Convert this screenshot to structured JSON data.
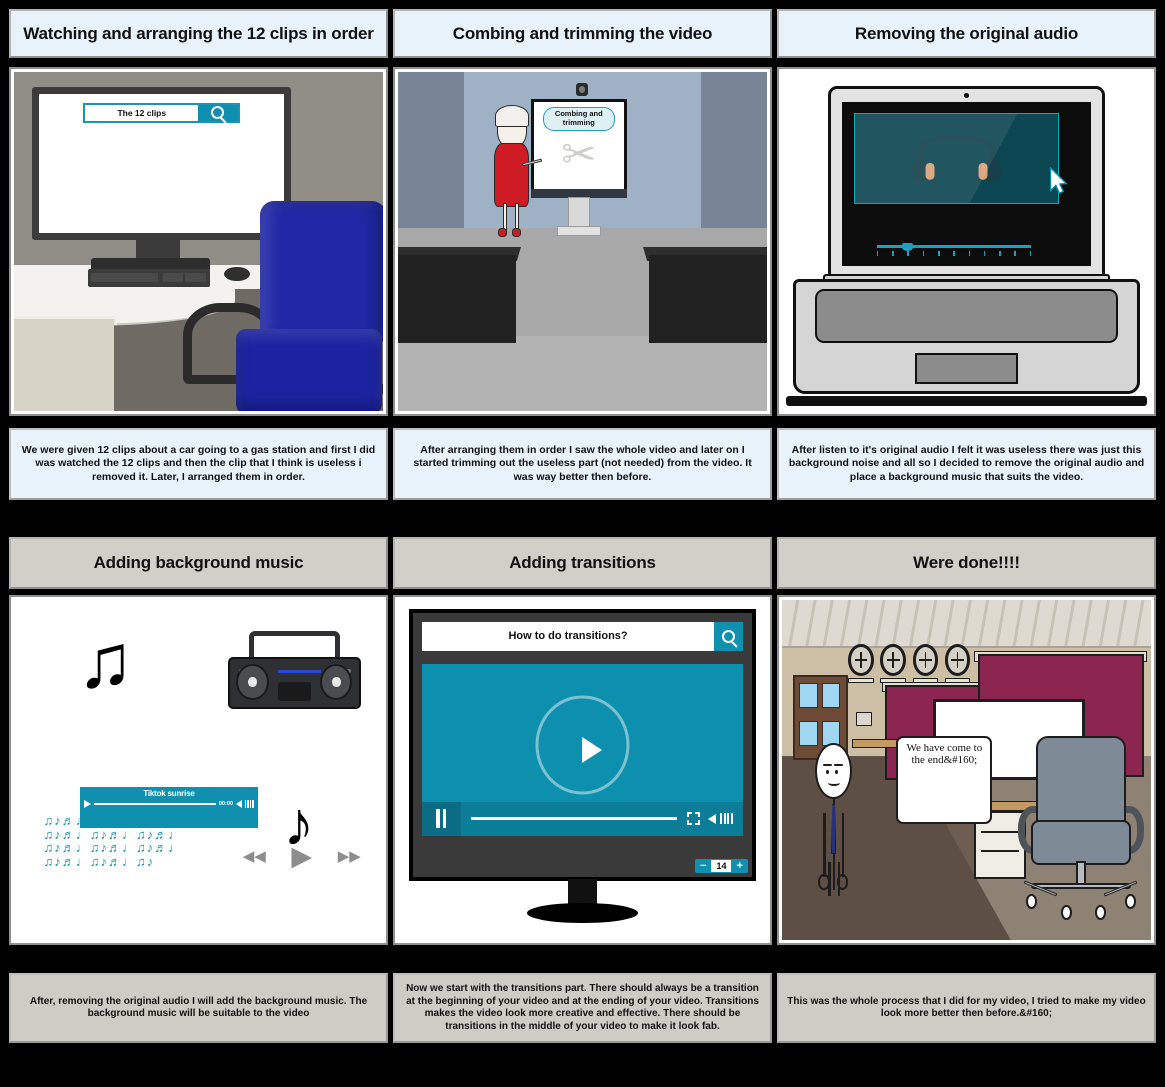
{
  "storyboard": {
    "panels": [
      {
        "title": "Watching and arranging the 12 clips in order",
        "caption": "We were given 12 clips about a car going to a gas station and first I did was watched the 12 clips and then the clip that I think is useless i removed it. Later, I arranged them in order.",
        "scene": {
          "search_query": "The 12 clips",
          "search_icon": "magnifier-icon"
        }
      },
      {
        "title": "Combing and trimming the video",
        "caption": "After arranging them in order I saw the whole video and later on I started trimming out the useless part (not needed) from the video. It was way better then before.",
        "scene": {
          "screen_label": "Combing and trimming",
          "screen_icon": "scissors-icon"
        }
      },
      {
        "title": "Removing the original audio",
        "caption": "After listen to it's original audio I felt it was useless there was just this background noise and all so I decided to remove the original audio and place a background music that suits the video.",
        "scene": {
          "media_icon": "headphones-icon",
          "cursor_icon": "mouse-pointer-icon",
          "slider_icon": "audio-slider"
        }
      },
      {
        "title": "Adding background music",
        "caption": "After, removing the original audio I will add the background music. The background music will be suitable to the video",
        "scene": {
          "player_track_title": "Tiktok sunrise",
          "player_time": "00:00",
          "play_icon": "play-icon",
          "volume_icon": "speaker-icon",
          "rewind_icon": "rewind-icon",
          "forward_icon": "fast-forward-icon",
          "boombox_icon": "boombox-icon",
          "note_glyph": "♫",
          "single_note_glyph": "♪",
          "note_swarm_glyphs": "♫♪♬♩♫♪♬♩♫♪♬♩♫♪♬♩♫♪♬♩♫♪♬♩♫♪♬♩♫♪♬♩♫♪♬♩♫♪♬♩♫♪♬♩♫♪"
        }
      },
      {
        "title": "Adding transitions",
        "caption": "Now we start with the transitions part. There should always be a transition at the beginning of your video and at the ending of your video. Transitions makes the video look more creative and effective. There should be transitions in the middle of your video to make it look fab.",
        "scene": {
          "search_query": "How to do transitions?",
          "search_icon": "magnifier-icon",
          "play_icon": "play-icon",
          "pause_icon": "pause-icon",
          "fullscreen_icon": "fullscreen-icon",
          "volume_icon": "speaker-icon",
          "zoom_minus": "−",
          "zoom_value": "14",
          "zoom_plus": "+"
        }
      },
      {
        "title": "Were done!!!!",
        "caption": "This was the whole process that I did for my video, I tried to make my video look more better then before.&#160;",
        "scene": {
          "speech_text": "We have come to the end&#160;"
        }
      }
    ]
  },
  "colors": {
    "accent_teal": "#0e90ae",
    "title_blue": "#e8f2fb",
    "title_gray": "#d2cfc8",
    "caption_gray": "#cfccc5",
    "chair_blue": "#2128a6",
    "dress_red": "#cf1c24",
    "cubicle_magenta": "#8c2550",
    "frame_border": "#8f8f8f",
    "page_background": "#000000"
  }
}
